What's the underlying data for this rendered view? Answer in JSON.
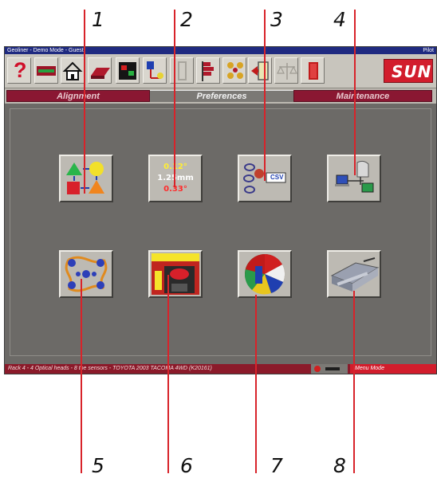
{
  "callouts": [
    "1",
    "2",
    "3",
    "4",
    "5",
    "6",
    "7",
    "8"
  ],
  "window": {
    "title": "Geoliner - Demo Mode - Guest",
    "title_right": "Pilot"
  },
  "toolbar": {
    "items": [
      {
        "name": "help-icon",
        "glyph": "?"
      },
      {
        "name": "vehicle-specs-icon"
      },
      {
        "name": "home-icon"
      },
      {
        "name": "procedure-icon"
      },
      {
        "name": "sensor-icon"
      },
      {
        "name": "target-icon"
      },
      {
        "name": "disabled-icon"
      },
      {
        "name": "flags-icon"
      },
      {
        "name": "wheels-icon"
      },
      {
        "name": "exit-door-icon"
      },
      {
        "name": "balance-scale-icon"
      },
      {
        "name": "print-icon"
      },
      {
        "name": "brand-logo",
        "text": "SUN"
      }
    ]
  },
  "tabs": {
    "alignment": "Alignment",
    "preferences": "Preferences",
    "maintenance": "Maintenance"
  },
  "preferences": {
    "buttons": [
      {
        "name": "shapes-button"
      },
      {
        "name": "units-button",
        "lines": [
          "0.12°",
          "1.25mm",
          "0.33°"
        ]
      },
      {
        "name": "csv-export-button",
        "label": "CSV"
      },
      {
        "name": "network-button"
      },
      {
        "name": "wheel-sensors-button"
      },
      {
        "name": "garage-button"
      },
      {
        "name": "language-flags-button"
      },
      {
        "name": "alignment-rack-button"
      }
    ]
  },
  "status": {
    "left": "Rack 4 - 4 Optical heads - 8 toe sensors - TOYOTA 2003 TACOMA 4WD (K20161)",
    "right": "Menu Mode"
  },
  "colors": {
    "accent_red": "#8a1732",
    "leader_red": "#d8232a",
    "window_gray": "#6c6a67",
    "units_yellow": "#ffee33",
    "units_white": "#ffffff",
    "units_red": "#ff2b2b"
  }
}
